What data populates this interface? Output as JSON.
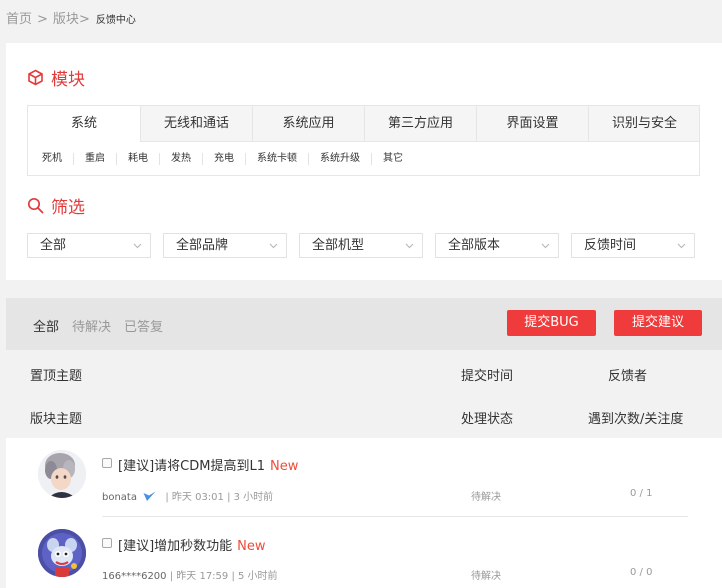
{
  "breadcrumb": {
    "home": "首页",
    "section": "版块",
    "current": "反馈中心",
    "separator": ">"
  },
  "module": {
    "title": "模块",
    "tabs": [
      "系统",
      "无线和通话",
      "系统应用",
      "第三方应用",
      "界面设置",
      "识别与安全"
    ],
    "subtabs": [
      "死机",
      "重启",
      "耗电",
      "发热",
      "充电",
      "系统卡顿",
      "系统升级",
      "其它"
    ]
  },
  "filter": {
    "title": "筛选",
    "selects": [
      "全部",
      "全部品牌",
      "全部机型",
      "全部版本",
      "反馈时间"
    ]
  },
  "toolbar": {
    "status_tabs": [
      "全部",
      "待解决",
      "已答复"
    ],
    "submit_bug": "提交BUG",
    "submit_suggestion": "提交建议"
  },
  "table_header": {
    "pinned_topics": "置顶主题",
    "submit_time": "提交时间",
    "reporter": "反馈者",
    "section_topics": "版块主题",
    "status": "处理状态",
    "count_follow": "遇到次数/关注度"
  },
  "posts": [
    {
      "title": "[建议]请将CDM提高到L1",
      "tag": "New",
      "user": "bonata",
      "date": "| 昨天 03:01",
      "ago": "| 3 小时前",
      "status": "待解决",
      "count": "0 / 1"
    },
    {
      "title": "[建议]增加秒数功能",
      "tag": "New",
      "user": "166****6200",
      "date": "| 昨天 17:59",
      "ago": "| 5 小时前",
      "status": "待解决",
      "count": "0 / 0"
    }
  ],
  "colors": {
    "accent": "#ef3b3b",
    "title_red": "#e33b3b"
  }
}
